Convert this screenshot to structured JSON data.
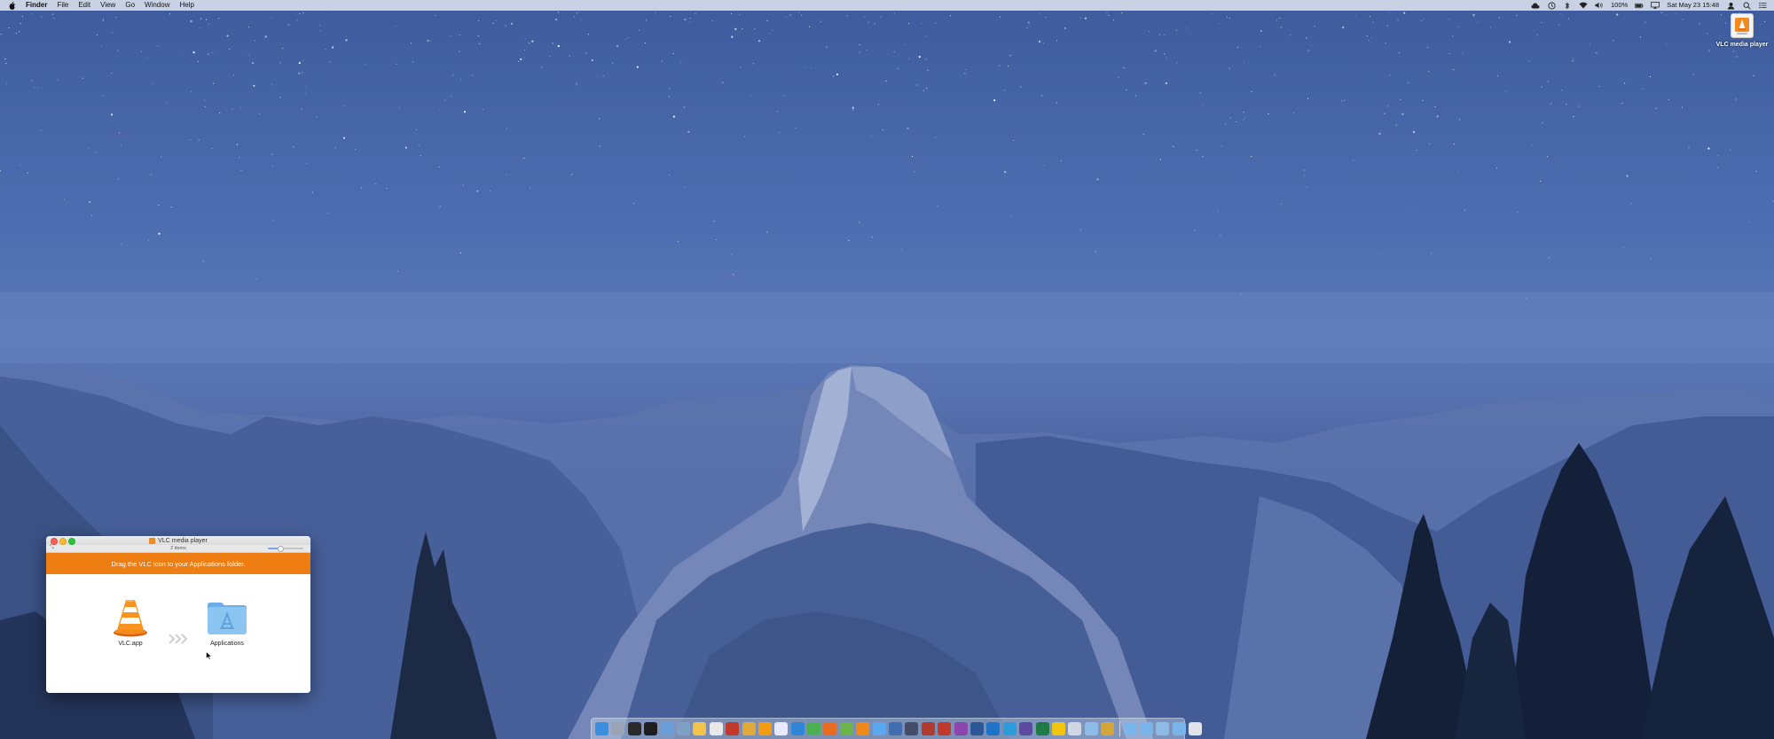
{
  "menubar": {
    "app_name": "Finder",
    "menus": [
      "File",
      "Edit",
      "View",
      "Go",
      "Window",
      "Help"
    ],
    "status": {
      "battery": "100%",
      "datetime": "Sat May 23  15:48"
    },
    "icons": [
      "creative-cloud-icon",
      "time-machine-icon",
      "bluetooth-icon",
      "wifi-icon",
      "volume-icon",
      "battery-icon",
      "airplay-icon",
      "user-icon",
      "spotlight-search-icon",
      "notification-center-icon"
    ]
  },
  "desktop": {
    "volume_icon_label": "VLC media player"
  },
  "finder_window": {
    "title": "VLC media player",
    "status": "2 items",
    "icon_size_fraction": 0.35,
    "banner_text": "Drag the VLC icon to your Applications folder.",
    "banner_color": "#ee7d12",
    "items": [
      {
        "label": "VLC.app",
        "icon": "vlc-cone-icon"
      },
      {
        "label": "Applications",
        "icon": "applications-folder-icon"
      }
    ]
  },
  "dock": {
    "apps": [
      {
        "name": "finder",
        "color": "#3b8fe0"
      },
      {
        "name": "launchpad",
        "color": "#9aa4b4"
      },
      {
        "name": "terminal-1",
        "color": "#2a2a2a"
      },
      {
        "name": "terminal-2",
        "color": "#1e1e1e"
      },
      {
        "name": "app-store",
        "color": "#6a9ed8"
      },
      {
        "name": "preview",
        "color": "#7da0c4"
      },
      {
        "name": "notes",
        "color": "#f2c34a"
      },
      {
        "name": "textedit",
        "color": "#e8e8e8"
      },
      {
        "name": "photo-booth",
        "color": "#c0392b"
      },
      {
        "name": "chrome",
        "color": "#e0a93a"
      },
      {
        "name": "sublime",
        "color": "#f39c12"
      },
      {
        "name": "itunes",
        "color": "#e8e8ff"
      },
      {
        "name": "safari",
        "color": "#2f86d6"
      },
      {
        "name": "chrome-2",
        "color": "#4caf50"
      },
      {
        "name": "firefox",
        "color": "#e76b21"
      },
      {
        "name": "maps",
        "color": "#6bb34a"
      },
      {
        "name": "vlc",
        "color": "#ef8a1a"
      },
      {
        "name": "messages",
        "color": "#5aa8f0"
      },
      {
        "name": "finder-2",
        "color": "#3f6fb0"
      },
      {
        "name": "quicktime",
        "color": "#444c6a"
      },
      {
        "name": "dictionary",
        "color": "#b03a2e"
      },
      {
        "name": "acrobat",
        "color": "#c0392b"
      },
      {
        "name": "onenote",
        "color": "#8e44ad"
      },
      {
        "name": "word",
        "color": "#2b5797"
      },
      {
        "name": "outlook",
        "color": "#1e73c8"
      },
      {
        "name": "skype",
        "color": "#2d9cdb"
      },
      {
        "name": "eclipse",
        "color": "#5b4a9e"
      },
      {
        "name": "excel",
        "color": "#1f7a43"
      },
      {
        "name": "sketch",
        "color": "#f1c40f"
      },
      {
        "name": "utility",
        "color": "#cfd8e3"
      },
      {
        "name": "cloud",
        "color": "#8fbbe8"
      },
      {
        "name": "wrench",
        "color": "#d4a63a"
      }
    ],
    "stacks": [
      {
        "name": "folder-1",
        "color": "#79b5ea"
      },
      {
        "name": "folder-2",
        "color": "#79b5ea"
      },
      {
        "name": "downloads",
        "color": "#8cbbe6"
      },
      {
        "name": "documents",
        "color": "#79b5ea"
      },
      {
        "name": "trash",
        "color": "#e0e4ea"
      }
    ]
  }
}
